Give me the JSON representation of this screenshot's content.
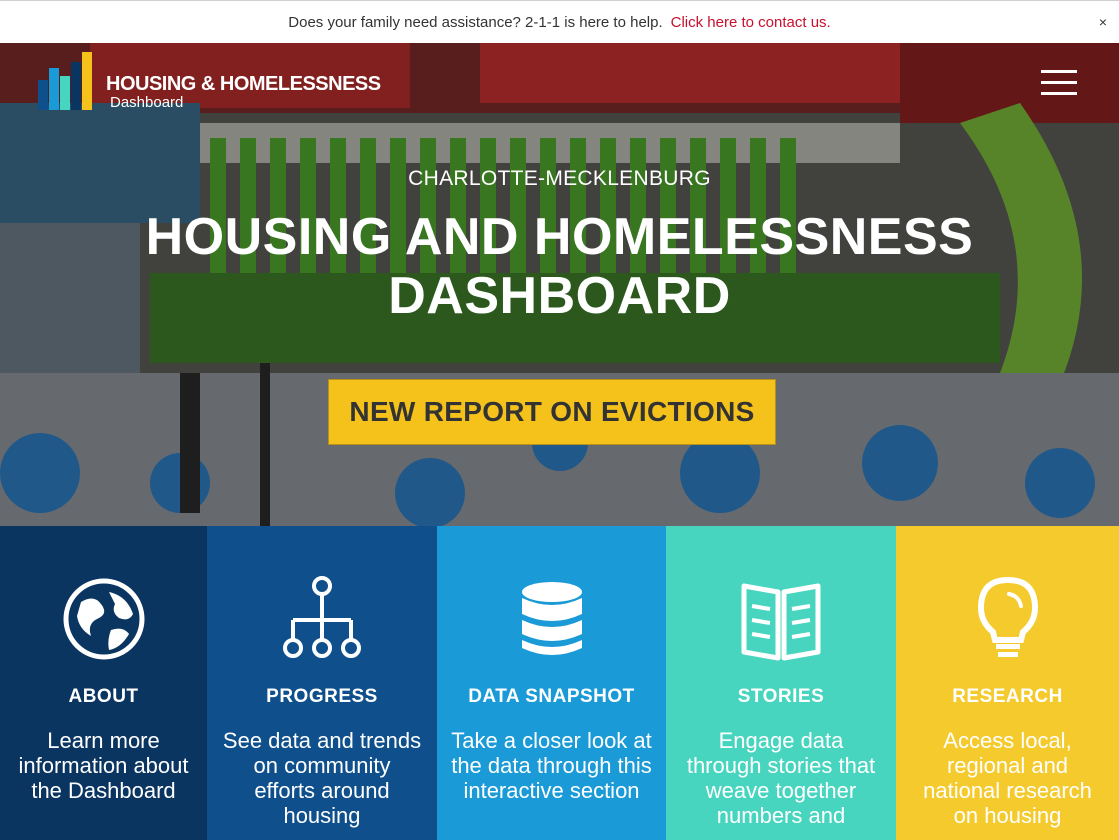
{
  "alert": {
    "message": "Does your family need assistance? 2-1-1 is here to help.",
    "link_text": "Click here to contact us.",
    "close_label": "×"
  },
  "header": {
    "logo_title": "HOUSING & HOMELESSNESS",
    "logo_subtitle": "Dashboard",
    "menu_icon": "hamburger-menu-icon"
  },
  "hero": {
    "eyebrow": "CHARLOTTE-MECKLENBURG",
    "title_line1": "HOUSING AND HOMELESSNESS",
    "title_line2": "DASHBOARD",
    "cta_label": "NEW REPORT ON EVICTIONS"
  },
  "tiles": [
    {
      "title": "ABOUT",
      "description": "Learn more information about the Dashboard",
      "icon": "globe-icon",
      "color": "#0b3561"
    },
    {
      "title": "PROGRESS",
      "description": "See data and trends on community efforts around housing",
      "icon": "hierarchy-icon",
      "color": "#0e4f8c"
    },
    {
      "title": "DATA SNAPSHOT",
      "description": "Take a closer look at the data through this interactive section",
      "icon": "database-icon",
      "color": "#1a9bd7"
    },
    {
      "title": "STORIES",
      "description": "Engage data through stories that weave together numbers and",
      "icon": "book-icon",
      "color": "#48d5bf"
    },
    {
      "title": "RESEARCH",
      "description": "Access local, regional and national research on housing",
      "icon": "lightbulb-icon",
      "color": "#f4ca2d"
    }
  ],
  "colors": {
    "accent_yellow": "#f4c21b",
    "alert_link": "#c8102e"
  }
}
